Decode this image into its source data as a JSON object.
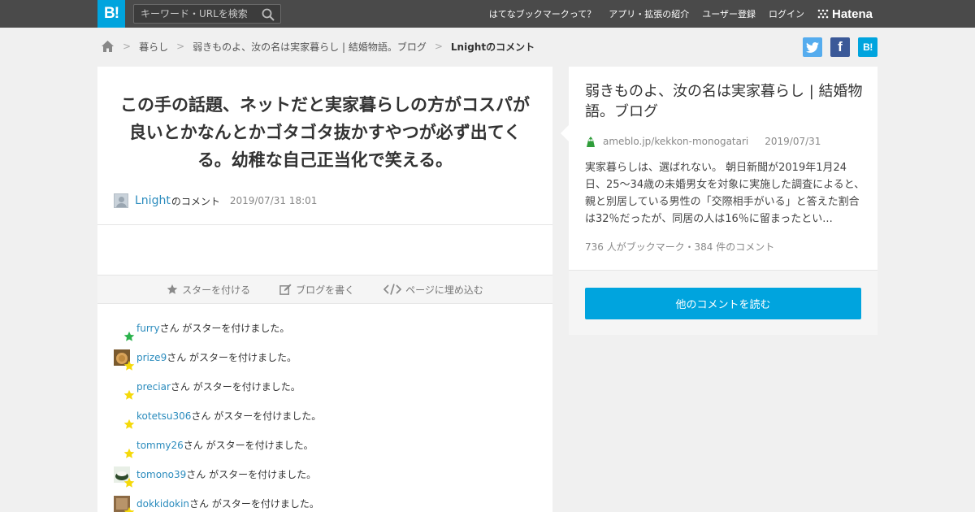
{
  "header": {
    "logo_text": "B!",
    "search_placeholder": "キーワード・URLを検索",
    "nav": [
      "はてなブックマークって？",
      "アプリ・拡張の紹介",
      "ユーザー登録",
      "ログイン"
    ],
    "brand": "Hatena"
  },
  "breadcrumb": {
    "category": "暮らし",
    "entry": "弱きものよ、汝の名は実家暮らし | 結婚物語。ブログ",
    "current": "Lnightのコメント"
  },
  "share": {
    "hatena_label": "B!",
    "facebook_label": "f"
  },
  "comment": {
    "text": "この手の話題、ネットだと実家暮らしの方がコスパが良いとかなんとかゴタゴタ抜かすやつが必ず出てくる。幼稚な自己正当化で笑える。",
    "user": "Lnight",
    "suffix": "のコメント",
    "date": "2019/07/31 18:01"
  },
  "actions": {
    "star": "スターを付ける",
    "blog": "ブログを書く",
    "embed": "ページに埋め込む"
  },
  "star_suffix": "さん がスターを付けました。",
  "stars": [
    {
      "user": "furry",
      "color": "green",
      "avatar": "none"
    },
    {
      "user": "prize9",
      "color": "yellow",
      "avatar": "brown"
    },
    {
      "user": "preciar",
      "color": "yellow",
      "avatar": "none"
    },
    {
      "user": "kotetsu306",
      "color": "yellow",
      "avatar": "none"
    },
    {
      "user": "tommy26",
      "color": "yellow",
      "avatar": "none"
    },
    {
      "user": "tomono39",
      "color": "yellow",
      "avatar": "bowl"
    },
    {
      "user": "dokkidokin",
      "color": "yellow",
      "avatar": "tan"
    }
  ],
  "entry": {
    "title": "弱きものよ、汝の名は実家暮らし | 結婚物語。ブログ",
    "domain": "ameblo.jp/kekkon-monogatari",
    "date": "2019/07/31",
    "summary": "実家暮らしは、選ばれない。 朝日新聞が2019年1月24日、25～34歳の未婚男女を対象に実施した調査によると、親と別居している男性の「交際相手がいる」と答えた割合は32％だったが、同居の人は16％に留まったとい...",
    "counts": "736 人がブックマーク・384 件のコメント",
    "read_more": "他のコメントを読む"
  },
  "colors": {
    "topbar": "#4a4a4a",
    "accent": "#00a4de",
    "link": "#2a8bbd",
    "star_green": "#2bb24c",
    "star_yellow": "#f5d90a",
    "twitter": "#55acee",
    "facebook": "#3b5998"
  }
}
